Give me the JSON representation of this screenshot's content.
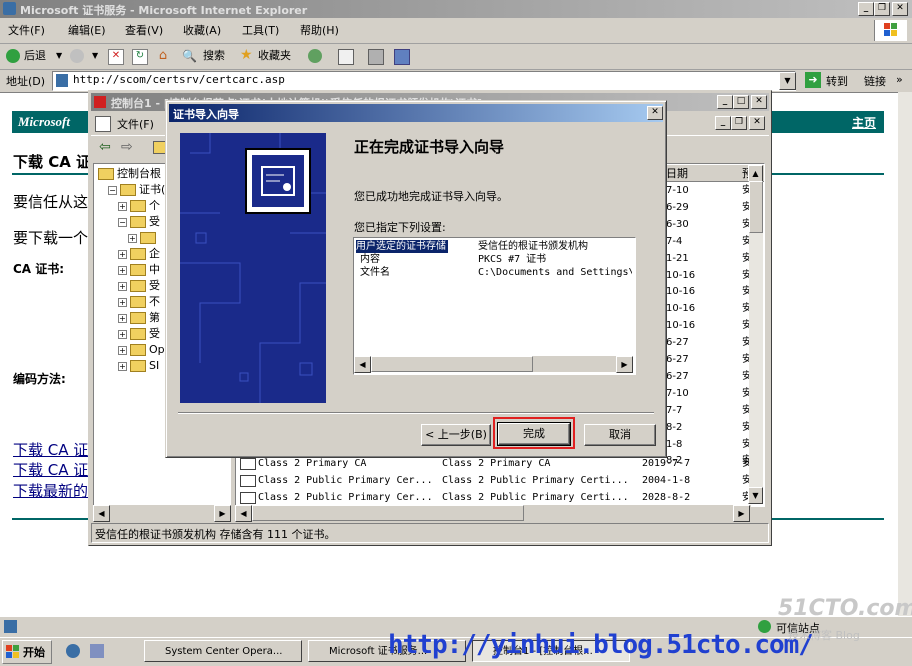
{
  "ie": {
    "title": "Microsoft 证书服务 - Microsoft Internet Explorer",
    "menu": [
      "文件(F)",
      "编辑(E)",
      "查看(V)",
      "收藏(A)",
      "工具(T)",
      "帮助(H)"
    ],
    "toolbar": {
      "back": "后退",
      "search": "搜索",
      "favorites": "收藏夹"
    },
    "address_label": "地址(D)",
    "address_value": "http://scom/certsrv/certcarc.asp",
    "go_label": "转到",
    "links_label": "链接",
    "status_text": "可信站点"
  },
  "page": {
    "banner_left": "Microsoft",
    "banner_right": "主页",
    "heading": "下载 CA 证",
    "para1": "要信任从这",
    "para2": "要下载一个",
    "ca_label": "CA 证书:",
    "encoding_label": "编码方法:",
    "links": [
      "下载 CA 证",
      "下载 CA 证",
      "下载最新的"
    ]
  },
  "mmc": {
    "title": "控制台1 - [控制台根节点\\证书(本地计算机)\\受信任的根证书颁发机构\\证书]",
    "menu_file": "文件(F)",
    "tree": [
      {
        "label": "控制台根",
        "indent": 0
      },
      {
        "label": "证书(",
        "indent": 1
      },
      {
        "label": "个",
        "indent": 2
      },
      {
        "label": "受",
        "indent": 2
      },
      {
        "label": "",
        "indent": 3
      },
      {
        "label": "企",
        "indent": 2
      },
      {
        "label": "中",
        "indent": 2
      },
      {
        "label": "受",
        "indent": 2
      },
      {
        "label": "不",
        "indent": 2
      },
      {
        "label": "第",
        "indent": 2
      },
      {
        "label": "受",
        "indent": 2
      },
      {
        "label": "Op",
        "indent": 2
      },
      {
        "label": "SI",
        "indent": 2
      }
    ],
    "col_date": "日期",
    "col_purpose": "预",
    "dates": [
      "7-10",
      "6-29",
      "6-30",
      "7-4",
      "1-21",
      "10-16",
      "10-16",
      "10-16",
      "10-16",
      "6-27",
      "6-27",
      "6-27",
      "7-10",
      "7-7",
      "8-2",
      "1-8",
      "8-2"
    ],
    "purpose_char": "安",
    "rows": [
      {
        "issued_to": "Class 2 Primary CA",
        "issued_by": "Class 2 Primary CA",
        "date": "2019-7-7",
        "purpose": "安"
      },
      {
        "issued_to": "Class 2 Public Primary Cer...",
        "issued_by": "Class 2 Public Primary Certi...",
        "date": "2004-1-8",
        "purpose": "安"
      },
      {
        "issued_to": "Class 2 Public Primary Cer...",
        "issued_by": "Class 2 Public Primary Certi...",
        "date": "2028-8-2",
        "purpose": "安"
      }
    ],
    "status": "受信任的根证书颁发机构 存储含有 111 个证书。"
  },
  "wizard": {
    "title": "证书导入向导",
    "heading": "正在完成证书导入向导",
    "success": "您已成功地完成证书导入向导。",
    "settings_label": "您已指定下列设置:",
    "settings": [
      {
        "key": "用户选定的证书存储",
        "value": "受信任的根证书颁发机构"
      },
      {
        "key": "内容",
        "value": "PKCS #7 证书"
      },
      {
        "key": "文件名",
        "value": "C:\\Documents and Settings\\"
      }
    ],
    "back_label": "< 上一步(B)",
    "finish_label": "完成",
    "cancel_label": "取消"
  },
  "taskbar": {
    "start": "开始",
    "tasks": [
      "System Center Opera...",
      "Microsoft 证书服务...",
      "控制台1 - [控制台根..."
    ],
    "watermark_url": "http://yinhui.blog.51cto.com/",
    "brand": "51CTO.com",
    "brand_sub": "技术博客  Blog"
  },
  "colors": {
    "accent": "#0a246a",
    "banner": "#006666",
    "highlight": "#e02020"
  }
}
